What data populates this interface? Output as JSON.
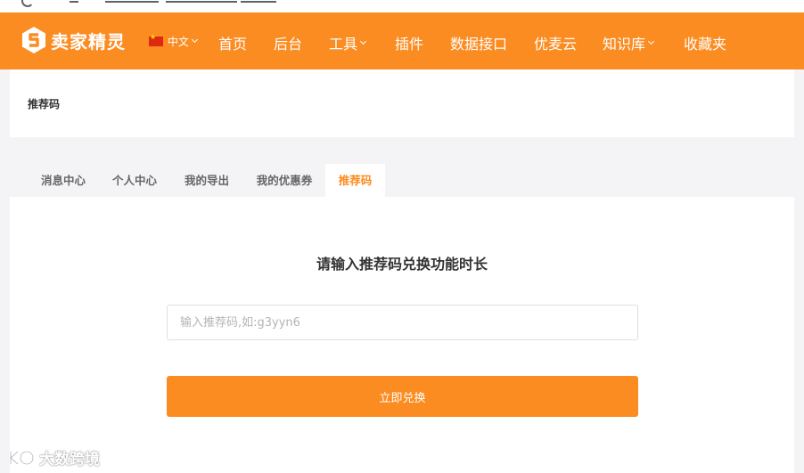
{
  "brand": {
    "name": "卖家精灵",
    "accent": "#fb8c22"
  },
  "language": {
    "label": "中文",
    "flag": "cn-flag-icon"
  },
  "nav": [
    {
      "label": "首页",
      "dropdown": false
    },
    {
      "label": "后台",
      "dropdown": false
    },
    {
      "label": "工具",
      "dropdown": true
    },
    {
      "label": "插件",
      "dropdown": false
    },
    {
      "label": "数据接口",
      "dropdown": false
    },
    {
      "label": "优麦云",
      "dropdown": false
    },
    {
      "label": "知识库",
      "dropdown": true
    },
    {
      "label": "收藏夹",
      "dropdown": false
    }
  ],
  "page": {
    "title": "推荐码"
  },
  "tabs": [
    {
      "label": "消息中心",
      "active": false
    },
    {
      "label": "个人中心",
      "active": false
    },
    {
      "label": "我的导出",
      "active": false
    },
    {
      "label": "我的优惠券",
      "active": false
    },
    {
      "label": "推荐码",
      "active": true
    }
  ],
  "redeem": {
    "heading": "请输入推荐码兑换功能时长",
    "input_value": "",
    "input_placeholder": "输入推荐码,如:g3yyn6",
    "button_label": "立即兑换"
  },
  "watermark": {
    "text": "大数跨境"
  }
}
